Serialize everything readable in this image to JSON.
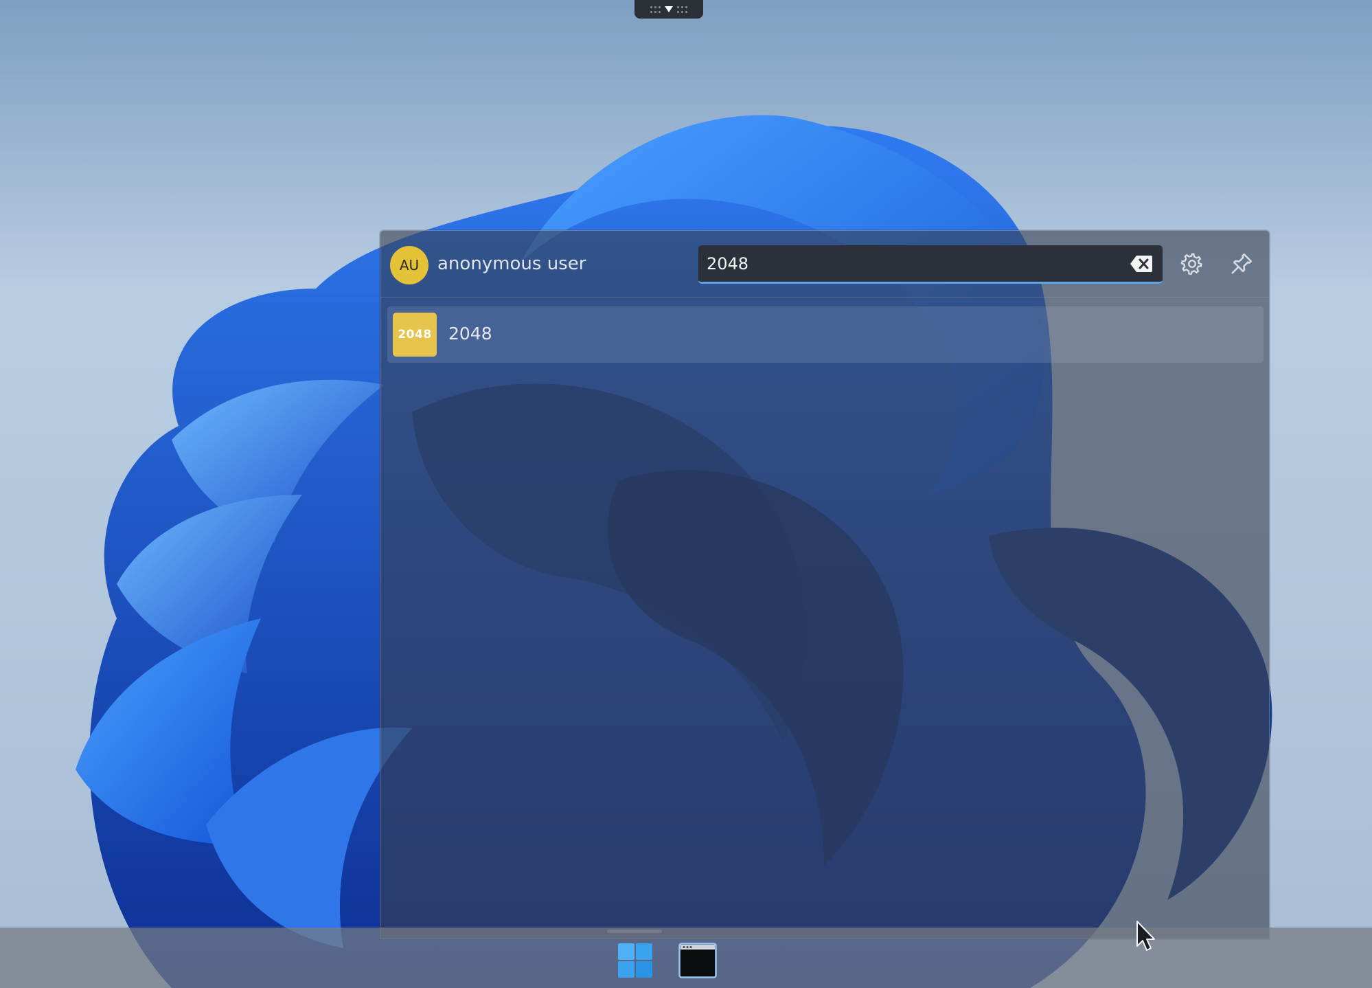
{
  "user": {
    "initials": "AU",
    "name": "anonymous user",
    "avatar_color": "#e4c237"
  },
  "search": {
    "value": "2048",
    "underline_color": "#5fa4e6"
  },
  "toolbar": {
    "clear_icon": "backspace-icon",
    "settings_icon": "gear-icon",
    "pin_icon": "pin-icon"
  },
  "results": [
    {
      "icon_text": "2048",
      "label": "2048",
      "icon_color": "#e7c44e"
    }
  ],
  "taskbar": {
    "items": [
      {
        "icon": "windows-start-icon"
      },
      {
        "icon": "terminal-window-icon"
      }
    ]
  }
}
